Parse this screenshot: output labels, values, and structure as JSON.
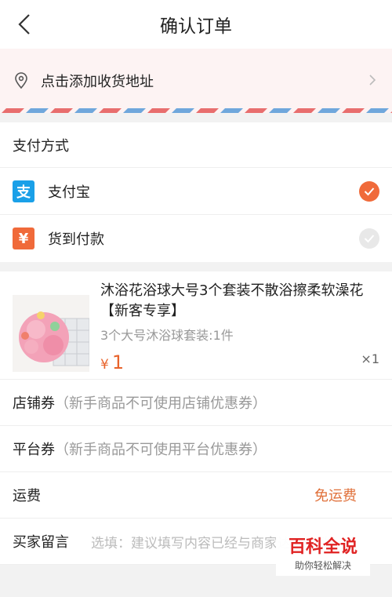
{
  "header": {
    "title": "确认订单",
    "back_icon": "chevron-left-icon"
  },
  "address": {
    "label": "点击添加收货地址",
    "icon": "location-pin-icon"
  },
  "payment": {
    "heading": "支付方式",
    "options": [
      {
        "label": "支付宝",
        "icon_glyph": "支",
        "icon": "alipay-icon",
        "color": "#1aa0e8",
        "selected": true
      },
      {
        "label": "货到付款",
        "icon_glyph": "¥",
        "icon": "cash-on-delivery-icon",
        "color": "#f06a3a",
        "selected": false
      }
    ]
  },
  "product": {
    "name": "沐浴花浴球大号3个套装不散浴擦柔软澡花【新客专享】",
    "spec": "3个大号沐浴球套装:1件",
    "currency": "¥",
    "price": "1",
    "quantity": "×1"
  },
  "coupons": {
    "store_label": "店铺券",
    "store_hint": "（新手商品不可使用店铺优惠券）",
    "platform_label": "平台券",
    "platform_hint": "（新手商品不可使用平台优惠券）"
  },
  "shipping": {
    "label": "运费",
    "value": "免运费"
  },
  "message": {
    "label": "买家留言",
    "placeholder": "选填：建议填写内容已经与商家达成一致"
  },
  "watermark": {
    "title": "百科全说",
    "subtitle": "助你轻松解决"
  },
  "colors": {
    "accent": "#f06a3a",
    "price": "#e8632b",
    "alipay": "#1aa0e8",
    "address_bg": "#fdf3f3"
  }
}
